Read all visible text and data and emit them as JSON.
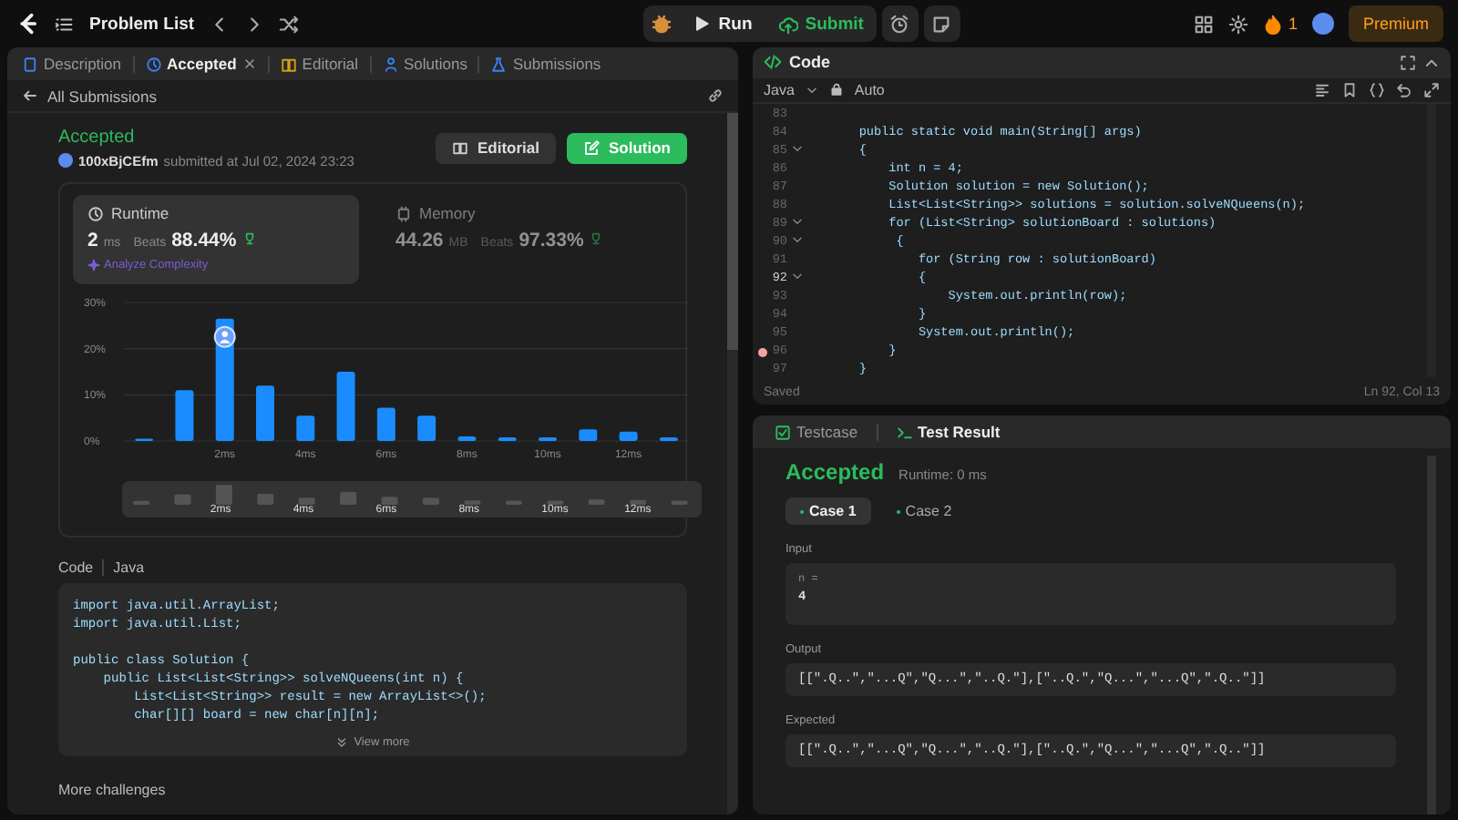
{
  "topbar": {
    "title": "Problem List",
    "run": "Run",
    "submit": "Submit",
    "streak": "1",
    "premium": "Premium"
  },
  "left_panel": {
    "tabs": [
      {
        "label": "Description",
        "selected": false,
        "closable": false
      },
      {
        "label": "Accepted",
        "selected": true,
        "closable": true
      },
      {
        "label": "Editorial",
        "selected": false,
        "closable": false
      },
      {
        "label": "Solutions",
        "selected": false,
        "closable": false
      },
      {
        "label": "Submissions",
        "selected": false,
        "closable": false
      }
    ],
    "back_link": "All Submissions",
    "submission": {
      "status": "Accepted",
      "user": "100xBjCEfm",
      "submitted": "submitted at Jul 02, 2024 23:23",
      "editorial_button": "Editorial",
      "solution_button": "Solution"
    },
    "stats": [
      {
        "kind": "runtime",
        "title": "Runtime",
        "value": "2",
        "unit": "ms",
        "beats_label": "Beats",
        "beats": "88.44%",
        "selected": true,
        "analyze": "Analyze Complexity"
      },
      {
        "kind": "memory",
        "title": "Memory",
        "value": "44.26",
        "unit": "MB",
        "beats_label": "Beats",
        "beats": "97.33%",
        "selected": false
      }
    ],
    "chart_data": {
      "type": "bar",
      "x": [
        0,
        1,
        2,
        3,
        4,
        5,
        6,
        7,
        8,
        9,
        10,
        11,
        12,
        13
      ],
      "xlim": [
        -0.5,
        13.5
      ],
      "series": [
        {
          "color": "#1a8cff",
          "values": [
            0.5,
            11,
            26.5,
            12,
            5.5,
            15,
            7.2,
            5.5,
            1,
            0.8,
            0.8,
            2.5,
            2,
            0.8
          ]
        }
      ],
      "ylim": [
        0,
        30
      ],
      "yticks": [
        {
          "value": 0,
          "label": "0%"
        },
        {
          "value": 10,
          "label": "10%"
        },
        {
          "value": 20,
          "label": "20%"
        },
        {
          "value": 30,
          "label": "30%"
        }
      ],
      "xticks": [
        {
          "value": 2,
          "label": "2ms"
        },
        {
          "value": 4,
          "label": "4ms"
        },
        {
          "value": 6,
          "label": "6ms"
        },
        {
          "value": 8,
          "label": "8ms"
        },
        {
          "value": 10,
          "label": "10ms"
        },
        {
          "value": 12,
          "label": "12ms"
        }
      ]
    },
    "overview_labels": [
      "2ms",
      "4ms",
      "6ms",
      "8ms",
      "10ms",
      "12ms"
    ],
    "code_header": {
      "label": "Code",
      "language": "Java"
    },
    "code_blocks": [
      [
        "import java.util.ArrayList;",
        "import java.util.List;"
      ],
      [
        "public class Solution {",
        "    public List<List<String>> solveNQueens(int n) {",
        "        List<List<String>> result = new ArrayList<>();",
        "        char[][] board = new char[n][n];"
      ]
    ],
    "view_more": "View more",
    "more_challenges": "More challenges"
  },
  "editor": {
    "title": "Code",
    "language": "Java",
    "mode": "Auto",
    "lines": [
      {
        "number": "83",
        "foldable": false,
        "breakpoint": false,
        "selected": false
      },
      {
        "number": "84",
        "text": "    public static void main(String[] args)",
        "foldable": false,
        "breakpoint": false,
        "selected": false
      },
      {
        "number": "85",
        "text": "    {",
        "foldable": true,
        "breakpoint": false,
        "selected": false
      },
      {
        "number": "86",
        "text": "        int n = 4;",
        "foldable": false,
        "breakpoint": false,
        "selected": false
      },
      {
        "number": "87",
        "text": "        Solution solution = new Solution();",
        "foldable": false,
        "breakpoint": false,
        "selected": false
      },
      {
        "number": "88",
        "text": "        List<List<String>> solutions = solution.solveNQueens(n);",
        "foldable": false,
        "breakpoint": false,
        "selected": false
      },
      {
        "number": "89",
        "text": "        for (List<String> solutionBoard : solutions)",
        "foldable": true,
        "breakpoint": false,
        "selected": false
      },
      {
        "number": "90",
        "text": "         {",
        "foldable": true,
        "breakpoint": false,
        "selected": false
      },
      {
        "number": "91",
        "text": "            for (String row : solutionBoard)",
        "foldable": false,
        "breakpoint": false,
        "selected": false
      },
      {
        "number": "92",
        "text": "            {",
        "foldable": true,
        "breakpoint": false,
        "selected": true
      },
      {
        "number": "93",
        "text": "                System.out.println(row);",
        "foldable": false,
        "breakpoint": false,
        "selected": false
      },
      {
        "number": "94",
        "text": "            }",
        "foldable": false,
        "breakpoint": false,
        "selected": false
      },
      {
        "number": "95",
        "text": "            System.out.println();",
        "foldable": false,
        "breakpoint": false,
        "selected": false
      },
      {
        "number": "96",
        "text": "        }",
        "foldable": false,
        "breakpoint": true,
        "selected": false
      },
      {
        "number": "97",
        "text": "    }",
        "foldable": false,
        "breakpoint": false,
        "selected": false
      }
    ],
    "status": "Saved",
    "cursor": "Ln 92, Col 13"
  },
  "results": {
    "tabs": [
      {
        "label": "Testcase",
        "selected": false
      },
      {
        "label": "Test Result",
        "selected": true
      }
    ],
    "status": "Accepted",
    "runtime": "Runtime: 0 ms",
    "cases": [
      {
        "label": "Case 1",
        "selected": true
      },
      {
        "label": "Case 2",
        "selected": false
      }
    ],
    "input_label": "Input",
    "input_name": "n =",
    "input_value": "4",
    "output_label": "Output",
    "output": "[[\".Q..\",\"...Q\",\"Q...\",\"..Q.\"],[\"..Q.\",\"Q...\",\"...Q\",\".Q..\"]]",
    "expected_label": "Expected",
    "expected": "[[\".Q..\",\"...Q\",\"Q...\",\"..Q.\"],[\"..Q.\",\"Q...\",\"...Q\",\".Q..\"]]"
  }
}
